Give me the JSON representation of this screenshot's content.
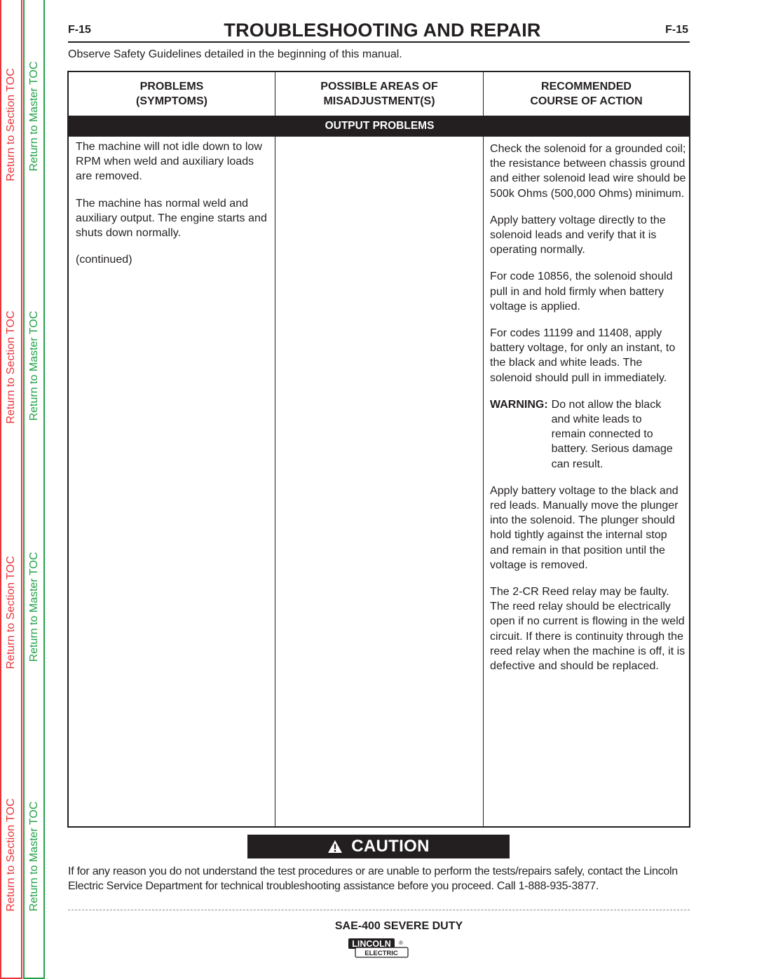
{
  "sidebar": {
    "section_links": [
      "Return to Section TOC",
      "Return to Section TOC",
      "Return to Section TOC",
      "Return to Section TOC"
    ],
    "master_links": [
      "Return to Master TOC",
      "Return to Master TOC",
      "Return to Master TOC",
      "Return to Master TOC"
    ],
    "colors": {
      "section": "#e8353a",
      "master": "#21a24a"
    }
  },
  "header": {
    "page_number_left": "F-15",
    "title": "TROUBLESHOOTING AND REPAIR",
    "page_number_right": "F-15"
  },
  "safety_note": "Observe Safety Guidelines detailed in the beginning of this manual.",
  "table": {
    "columns": [
      {
        "line1": "PROBLEMS",
        "line2": "(SYMPTOMS)"
      },
      {
        "line1": "POSSIBLE AREAS OF",
        "line2": "MISADJUSTMENT(S)"
      },
      {
        "line1": "RECOMMENDED",
        "line2": "COURSE OF ACTION"
      }
    ],
    "section_title": "OUTPUT PROBLEMS",
    "problems": [
      "The machine will not idle down to low RPM when weld and auxiliary loads are removed.",
      "The machine has normal weld and auxiliary output.  The engine starts and shuts down normally.",
      "(continued)"
    ],
    "misadjustments": [],
    "actions": [
      "Check the solenoid for a grounded coil; the resistance between chassis ground and either solenoid lead wire should be 500k Ohms (500,000 Ohms) minimum.",
      "Apply battery voltage directly to the solenoid leads and verify that it is operating normally.",
      "For code 10856, the solenoid should pull in and hold firmly when battery voltage is applied.",
      "For codes 11199 and 11408, apply battery voltage, for only an instant, to the black and white leads.  The solenoid should pull in immediately."
    ],
    "warning": {
      "label": "WARNING:",
      "text": "Do not allow the black and white leads to remain connected to battery. Serious damage can result."
    },
    "actions_after": [
      "Apply battery voltage to the black and red leads.  Manually move the plunger into the solenoid.  The plunger should hold tightly against the internal stop and remain in that position until the voltage is removed.",
      "The 2-CR Reed relay may be faulty.  The reed relay should be electrically open if no current is flowing in the weld circuit.  If there is continuity through the reed relay when the machine is off, it is defective and should be replaced."
    ]
  },
  "caution": {
    "icon": "warning-triangle-icon",
    "label": "CAUTION",
    "text": "If for any reason you do not understand the test procedures or are unable to perform the tests/repairs safely, contact the Lincoln Electric Service Department for technical troubleshooting assistance before you proceed. Call 1-888-935-3877."
  },
  "footer": {
    "model": "SAE-400 SEVERE DUTY",
    "logo_top": "LINCOLN",
    "logo_bottom": "ELECTRIC",
    "logo_mark": "®"
  }
}
